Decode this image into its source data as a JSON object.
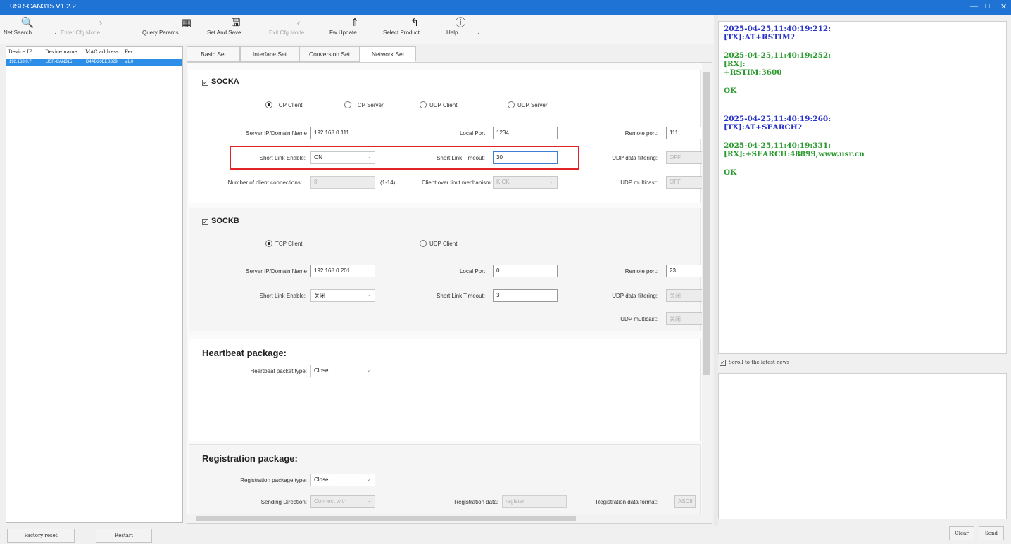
{
  "window": {
    "title": "USR-CAN315 V1.2.2",
    "minimize": "—",
    "maximize": "□",
    "close": "✕"
  },
  "toolbar": {
    "items": [
      {
        "label": "Net Search",
        "icon": "search-icon",
        "glyph": "🔍"
      },
      {
        "label": "Enter Cfg Mode",
        "icon": "chevron-right-icon",
        "glyph": "›"
      },
      {
        "label": "Query Params",
        "icon": "query-icon",
        "glyph": "▦"
      },
      {
        "label": "Set And Save",
        "icon": "save-icon",
        "glyph": "🖫"
      },
      {
        "label": "Exit Cfg Mode",
        "icon": "chevron-left-icon",
        "glyph": "‹"
      },
      {
        "label": "Fw Update",
        "icon": "rocket-icon",
        "glyph": "⇑"
      },
      {
        "label": "Select Product",
        "icon": "back-arrow-icon",
        "glyph": "↰"
      },
      {
        "label": "Help",
        "icon": "info-icon",
        "glyph": "ⓘ"
      }
    ]
  },
  "device_list": {
    "headers": [
      "Device IP",
      "Device name",
      "MAC address",
      "Fer"
    ],
    "rows": [
      [
        "192.168.0.7",
        "USR-CAN315",
        "D4AD20EEB329",
        "V1.0"
      ]
    ]
  },
  "tabs": [
    "Basic Set",
    "Interface Set",
    "Conversion Set",
    "Network Set"
  ],
  "socka": {
    "title": "SOCKA",
    "modes": [
      "TCP Client",
      "TCP Server",
      "UDP Client",
      "UDP Server"
    ],
    "server_label": "Server IP/Domain Name",
    "server_value": "192.168.0.111",
    "local_port_label": "Local Port",
    "local_port_value": "1234",
    "remote_port_label": "Remote port:",
    "remote_port_value": "111",
    "short_link_label": "Short Link Enable:",
    "short_link_value": "ON",
    "short_timeout_label": "Short Link Timeout:",
    "short_timeout_value": "30",
    "udp_filter_label": "UDP data filtering:",
    "udp_filter_value": "OFF",
    "clients_label": "Number of client connections:",
    "clients_value": "8",
    "clients_range": "(1-14)",
    "over_limit_label": "Client over limit mechanism:",
    "over_limit_value": "KICK",
    "udp_multicast_label": "UDP multicast:",
    "udp_multicast_value": "OFF"
  },
  "sockb": {
    "title": "SOCKB",
    "modes": [
      "TCP Client",
      "UDP Client"
    ],
    "server_label": "Server IP/Domain Name",
    "server_value": "192.168.0.201",
    "local_port_label": "Local Port",
    "local_port_value": "0",
    "remote_port_label": "Remote port:",
    "remote_port_value": "23",
    "short_link_label": "Short Link Enable:",
    "short_link_value": "关闭",
    "short_timeout_label": "Short Link Timeout:",
    "short_timeout_value": "3",
    "udp_filter_label": "UDP data filtering:",
    "udp_filter_value": "关闭",
    "udp_multicast_label": "UDP multicast:",
    "udp_multicast_value": "关闭"
  },
  "heartbeat": {
    "title": "Heartbeat package:",
    "type_label": "Heartbeat packet type:",
    "type_value": "Close"
  },
  "registration": {
    "title": "Registration package:",
    "type_label": "Registration package type:",
    "type_value": "Close",
    "direction_label": "Sending Direction:",
    "direction_value": "Connect with",
    "data_label": "Registration data:",
    "data_value": "register",
    "format_label": "Registration data format:",
    "format_value": "ASCII"
  },
  "log": [
    {
      "time": "2025-04-25,11:40:19:212:",
      "kind": "tx",
      "lines": [
        "[TX]:AT+RSTIM?"
      ]
    },
    {
      "time": "2025-04-25,11:40:19:252:",
      "kind": "rx",
      "lines": [
        "[RX]:",
        "+RSTIM:3600",
        "",
        "OK"
      ]
    },
    {
      "time": "2025-04-25,11:40:19:260:",
      "kind": "tx",
      "lines": [
        "[TX]:AT+SEARCH?"
      ]
    },
    {
      "time": "2025-04-25,11:40:19:331:",
      "kind": "rx",
      "lines": [
        "[RX]:+SEARCH:48899,www.usr.cn",
        "",
        "OK"
      ]
    }
  ],
  "scroll_latest": "Scroll to the latest news",
  "buttons": {
    "factory_reset": "Factory reset",
    "restart": "Restart",
    "clear": "Clear",
    "send": "Send"
  },
  "colors": {
    "titlebar": "#1e73d4",
    "tx": "#2732c9",
    "rx": "#2a9a2e",
    "highlight": "#e12424",
    "selected_row": "#2d8ee8"
  }
}
